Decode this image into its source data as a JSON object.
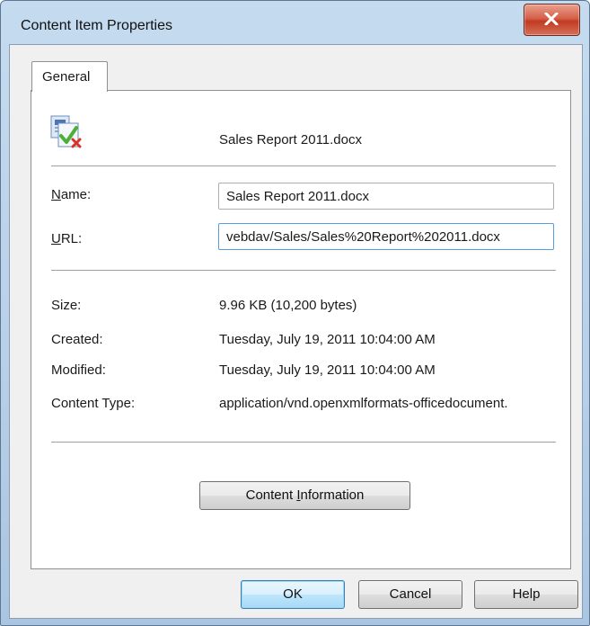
{
  "window": {
    "title": "Content Item Properties"
  },
  "tabs": [
    {
      "label": "General",
      "active": true
    }
  ],
  "header": {
    "icon": "word-document-icon",
    "file_name": "Sales Report 2011.docx"
  },
  "fields": {
    "name": {
      "label_prefix": "N",
      "label_rest": "ame:",
      "value": "Sales Report 2011.docx"
    },
    "url": {
      "label_prefix": "U",
      "label_rest": "RL:",
      "value": "vebdav/Sales/Sales%20Report%202011.docx"
    }
  },
  "properties": [
    {
      "label": "Size:",
      "value": "9.96 KB (10,200 bytes)"
    },
    {
      "label": "Created:",
      "value": "Tuesday, July 19, 2011 10:04:00 AM"
    },
    {
      "label": "Modified:",
      "value": "Tuesday, July 19, 2011 10:04:00 AM"
    },
    {
      "label": "Content Type:",
      "value": "application/vnd.openxmlformats-officedocument."
    }
  ],
  "buttons": {
    "content_info_pre": "Content ",
    "content_info_key": "I",
    "content_info_post": "nformation",
    "ok": "OK",
    "cancel": "Cancel",
    "help": "Help"
  },
  "colors": {
    "frame": "#b7cfe8",
    "close": "#c23b22",
    "default_button_border": "#3c7fb1"
  }
}
